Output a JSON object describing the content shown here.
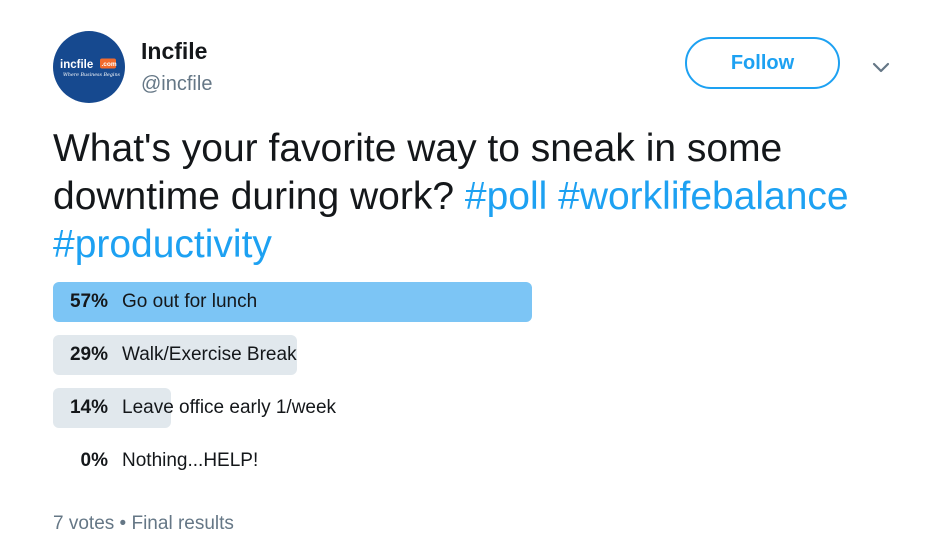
{
  "author": {
    "display_name": "Incfile",
    "handle": "@incfile",
    "avatar_logo_text": "incfile.com",
    "avatar_tagline": "Where Business Begins",
    "avatar_bg_color": "#16498f"
  },
  "follow_button": {
    "label": "Follow",
    "color": "#1da1f2"
  },
  "menu": {
    "icon": "chevron-down-icon"
  },
  "tweet": {
    "text_plain": "What's your favorite way to sneak in some downtime during work?",
    "hashtags": [
      "#poll",
      "#worklifebalance",
      "#productivity"
    ]
  },
  "poll": {
    "options": [
      {
        "percent_label": "57%",
        "value": 57,
        "label": "Go out for lunch",
        "winner": true
      },
      {
        "percent_label": "29%",
        "value": 29,
        "label": "Walk/Exercise Break",
        "winner": false
      },
      {
        "percent_label": "14%",
        "value": 14,
        "label": "Leave office early 1/week",
        "winner": false
      },
      {
        "percent_label": "0%",
        "value": 0,
        "label": "Nothing...HELP!",
        "winner": false
      }
    ],
    "votes": "7 votes",
    "separator": "•",
    "status": "Final results",
    "winner_color": "#7cc5f5",
    "other_color": "#e1e8ed"
  }
}
